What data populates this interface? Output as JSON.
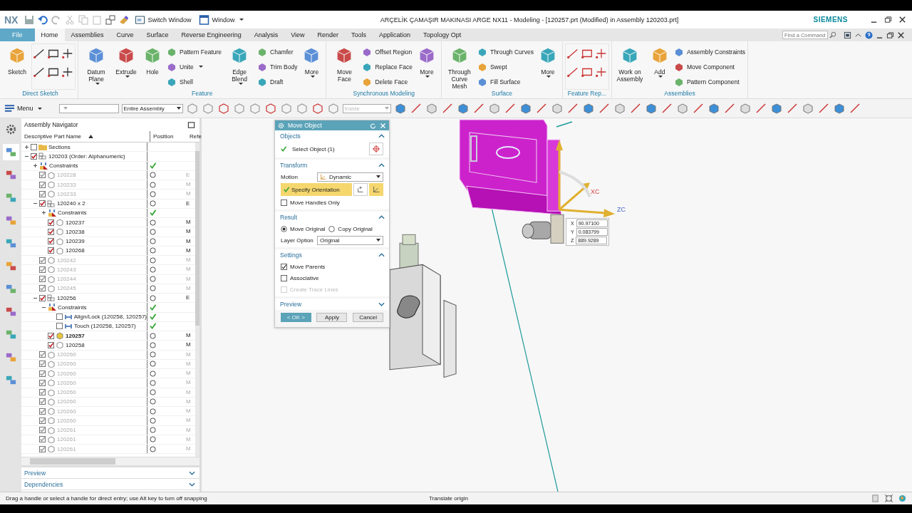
{
  "title_bar": {
    "logo": "NX",
    "switch_window": "Switch Window",
    "window_menu": "Window",
    "title": "ARÇELİK ÇAMAŞIR MAKINASI ARGE NX11 - Modeling - [120257.prt (Modified)  in Assembly 120203.prt]",
    "brand": "SIEMENS"
  },
  "menu_tabs": [
    {
      "label": "File",
      "kind": "file",
      "selected": false
    },
    {
      "label": "Home",
      "kind": "tab",
      "selected": true
    },
    {
      "label": "Assemblies",
      "kind": "tab",
      "selected": false
    },
    {
      "label": "Curve",
      "kind": "tab",
      "selected": false
    },
    {
      "label": "Surface",
      "kind": "tab",
      "selected": false
    },
    {
      "label": "Reverse Engineering",
      "kind": "tab",
      "selected": false
    },
    {
      "label": "Analysis",
      "kind": "tab",
      "selected": false
    },
    {
      "label": "View",
      "kind": "tab",
      "selected": false
    },
    {
      "label": "Render",
      "kind": "tab",
      "selected": false
    },
    {
      "label": "Tools",
      "kind": "tab",
      "selected": false
    },
    {
      "label": "Application",
      "kind": "tab",
      "selected": false
    },
    {
      "label": "Topology Opt",
      "kind": "tab",
      "selected": false
    }
  ],
  "command_search": {
    "placeholder": "Find a Command"
  },
  "ribbon_groups": [
    {
      "label": "Direct Sketch",
      "items": [
        {
          "kind": "large",
          "label": "Sketch",
          "dropdown": false
        },
        {
          "kind": "grid"
        }
      ]
    },
    {
      "label": "Feature",
      "items": [
        {
          "kind": "large",
          "label": "Datum Plane",
          "dropdown": true
        },
        {
          "kind": "large",
          "label": "Extrude",
          "dropdown": true
        },
        {
          "kind": "large",
          "label": "Hole",
          "dropdown": false
        },
        {
          "kind": "stack",
          "entries": [
            {
              "label": "Pattern Feature",
              "dropdown": false
            },
            {
              "label": "Unite",
              "dropdown": true
            },
            {
              "label": "Shell",
              "dropdown": false
            }
          ]
        },
        {
          "kind": "large",
          "label": "Edge Blend",
          "dropdown": true
        },
        {
          "kind": "stack",
          "entries": [
            {
              "label": "Chamfer",
              "dropdown": false
            },
            {
              "label": "Trim Body",
              "dropdown": false
            },
            {
              "label": "Draft",
              "dropdown": false
            }
          ]
        },
        {
          "kind": "large",
          "label": "More",
          "dropdown": true
        }
      ]
    },
    {
      "label": "Synchronous Modeling",
      "items": [
        {
          "kind": "large",
          "label": "Move Face",
          "dropdown": false
        },
        {
          "kind": "stack",
          "entries": [
            {
              "label": "Offset Region",
              "dropdown": false
            },
            {
              "label": "Replace Face",
              "dropdown": false
            },
            {
              "label": "Delete Face",
              "dropdown": false
            }
          ]
        },
        {
          "kind": "large",
          "label": "More",
          "dropdown": true
        }
      ]
    },
    {
      "label": "Surface",
      "items": [
        {
          "kind": "large",
          "label": "Through Curve Mesh",
          "dropdown": false
        },
        {
          "kind": "stack",
          "entries": [
            {
              "label": "Through Curves",
              "dropdown": false
            },
            {
              "label": "Swept",
              "dropdown": false
            },
            {
              "label": "Fill Surface",
              "dropdown": false
            }
          ]
        },
        {
          "kind": "large",
          "label": "More",
          "dropdown": true
        }
      ]
    },
    {
      "label": "Feature Rep...",
      "items": [
        {
          "kind": "grid"
        }
      ]
    },
    {
      "label": "Assemblies",
      "items": [
        {
          "kind": "large",
          "label": "Work on Assembly",
          "dropdown": false
        },
        {
          "kind": "large",
          "label": "Add",
          "dropdown": true
        },
        {
          "kind": "stack",
          "entries": [
            {
              "label": "Assembly Constraints",
              "dropdown": false
            },
            {
              "label": "Move Component",
              "dropdown": false
            },
            {
              "label": "Pattern Component",
              "dropdown": false
            }
          ]
        }
      ]
    }
  ],
  "selection_bar": {
    "menu": "Menu",
    "scope": "Entire Assembly",
    "inside": "Inside"
  },
  "navigator": {
    "title": "Assembly Navigator",
    "columns": [
      "Descriptive Part Name",
      "Position",
      "Refe"
    ],
    "tree": [
      {
        "name": "Sections",
        "kind": "folder",
        "checked": false,
        "dimmed": false,
        "work": false,
        "expanded": false
      },
      {
        "name": "120203 (Order: Alphanumeric)",
        "kind": "assembly",
        "checked": true,
        "dimmed": false,
        "work": false,
        "expanded": true,
        "children": [
          {
            "name": "Constraints",
            "kind": "constraints",
            "dimmed": false,
            "work": false,
            "expanded": false,
            "positioned": true
          },
          {
            "name": "120228",
            "kind": "part",
            "checked": true,
            "dimmed": true,
            "work": false,
            "positioned": false,
            "reference": "E"
          },
          {
            "name": "120233",
            "kind": "part",
            "checked": true,
            "dimmed": true,
            "work": false,
            "positioned": false,
            "reference": "M"
          },
          {
            "name": "120233",
            "kind": "part",
            "checked": true,
            "dimmed": true,
            "work": false,
            "positioned": false,
            "reference": "M"
          },
          {
            "name": "120240 x 2",
            "kind": "assembly",
            "checked": true,
            "dimmed": false,
            "work": false,
            "expanded": true,
            "positioned": false,
            "reference": "E",
            "children": [
              {
                "name": "Constraints",
                "kind": "constraints",
                "dimmed": false,
                "work": false,
                "expanded": false,
                "positioned": true
              },
              {
                "name": "120237",
                "kind": "part",
                "checked": true,
                "dimmed": false,
                "work": false,
                "positioned": false,
                "reference": "M"
              },
              {
                "name": "120238",
                "kind": "part",
                "checked": true,
                "dimmed": false,
                "work": false,
                "positioned": false,
                "reference": "M"
              },
              {
                "name": "120239",
                "kind": "part",
                "checked": true,
                "dimmed": false,
                "work": false,
                "positioned": false,
                "reference": "M"
              },
              {
                "name": "120268",
                "kind": "part",
                "checked": true,
                "dimmed": false,
                "work": false,
                "positioned": false,
                "reference": "M"
              }
            ]
          },
          {
            "name": "120242",
            "kind": "part",
            "checked": true,
            "dimmed": true,
            "work": false,
            "positioned": false,
            "reference": "M"
          },
          {
            "name": "120243",
            "kind": "part",
            "checked": true,
            "dimmed": true,
            "work": false,
            "positioned": false,
            "reference": "M"
          },
          {
            "name": "120244",
            "kind": "part",
            "checked": true,
            "dimmed": true,
            "work": false,
            "positioned": false,
            "reference": "M"
          },
          {
            "name": "120245",
            "kind": "part",
            "checked": true,
            "dimmed": true,
            "work": false,
            "positioned": false,
            "reference": "M"
          },
          {
            "name": "120256",
            "kind": "assembly",
            "checked": true,
            "dimmed": false,
            "work": false,
            "expanded": true,
            "positioned": false,
            "reference": "E",
            "children": [
              {
                "name": "Constraints",
                "kind": "constraints",
                "dimmed": false,
                "work": false,
                "expanded": true,
                "positioned": true,
                "children": [
                  {
                    "name": "Align/Lock (120258, 120257)",
                    "kind": "constraint",
                    "checked": false,
                    "dimmed": false,
                    "work": false,
                    "positioned": true
                  },
                  {
                    "name": "Touch (120258, 120257)",
                    "kind": "constraint",
                    "checked": false,
                    "dimmed": false,
                    "work": false,
                    "positioned": true
                  }
                ]
              },
              {
                "name": "120257",
                "kind": "part",
                "checked": true,
                "dimmed": false,
                "work": true,
                "positioned": false,
                "reference": "M"
              },
              {
                "name": "120258",
                "kind": "part",
                "checked": true,
                "dimmed": false,
                "work": false,
                "positioned": false,
                "reference": "M"
              }
            ]
          },
          {
            "name": "120260",
            "kind": "part",
            "checked": true,
            "dimmed": true,
            "work": false,
            "positioned": false,
            "reference": "M"
          },
          {
            "name": "120260",
            "kind": "part",
            "checked": true,
            "dimmed": true,
            "work": false,
            "positioned": false,
            "reference": "M"
          },
          {
            "name": "120260",
            "kind": "part",
            "checked": true,
            "dimmed": true,
            "work": false,
            "positioned": false,
            "reference": "M"
          },
          {
            "name": "120260",
            "kind": "part",
            "checked": true,
            "dimmed": true,
            "work": false,
            "positioned": false,
            "reference": "M"
          },
          {
            "name": "120260",
            "kind": "part",
            "checked": true,
            "dimmed": true,
            "work": false,
            "positioned": false,
            "reference": "M"
          },
          {
            "name": "120260",
            "kind": "part",
            "checked": true,
            "dimmed": true,
            "work": false,
            "positioned": false,
            "reference": "M"
          },
          {
            "name": "120260",
            "kind": "part",
            "checked": true,
            "dimmed": true,
            "work": false,
            "positioned": false,
            "reference": "M"
          },
          {
            "name": "120260",
            "kind": "part",
            "checked": true,
            "dimmed": true,
            "work": false,
            "positioned": false,
            "reference": "M"
          },
          {
            "name": "120261",
            "kind": "part",
            "checked": true,
            "dimmed": true,
            "work": false,
            "positioned": false,
            "reference": "M"
          },
          {
            "name": "120261",
            "kind": "part",
            "checked": true,
            "dimmed": true,
            "work": false,
            "positioned": false,
            "reference": "M"
          },
          {
            "name": "120261",
            "kind": "part",
            "checked": true,
            "dimmed": true,
            "work": false,
            "positioned": false,
            "reference": "M"
          }
        ]
      }
    ],
    "panels": [
      {
        "title": "Preview",
        "expanded": false
      },
      {
        "title": "Dependencies",
        "expanded": false
      }
    ]
  },
  "dialog": {
    "title": "Move Object",
    "sections": [
      {
        "kind": "objects",
        "title": "Objects",
        "expanded": true,
        "selector": "Select Object (1)",
        "done": true
      },
      {
        "kind": "transform",
        "title": "Transform",
        "expanded": true,
        "motion_label": "Motion",
        "motion": "Dynamic",
        "orientation": "Specify Orientation",
        "orientation_done": true,
        "options": [
          {
            "label": "Move Handles Only",
            "checked": false,
            "disabled": false
          }
        ]
      },
      {
        "kind": "result",
        "title": "Result",
        "expanded": true,
        "modes": [
          {
            "label": "Move Original",
            "selected": true
          },
          {
            "label": "Copy Original",
            "selected": false
          }
        ],
        "layer_label": "Layer Option",
        "layer": "Original"
      },
      {
        "kind": "settings",
        "title": "Settings",
        "expanded": true,
        "options": [
          {
            "label": "Move Parents",
            "checked": true,
            "disabled": false
          },
          {
            "label": "Associative",
            "checked": false,
            "disabled": false
          },
          {
            "label": "Create Trace Lines",
            "checked": false,
            "disabled": true
          }
        ]
      },
      {
        "kind": "preview",
        "title": "Preview",
        "expanded": false
      }
    ],
    "buttons": [
      {
        "label": "< OK >",
        "kind": "primary"
      },
      {
        "label": "Apply",
        "kind": "normal"
      },
      {
        "label": "Cancel",
        "kind": "normal"
      }
    ]
  },
  "viewport": {
    "axis_labels": [
      "XC",
      "ZC"
    ],
    "coordinates": [
      {
        "axis": "X",
        "value": "90.97100"
      },
      {
        "axis": "Y",
        "value": "0.083799"
      },
      {
        "axis": "Z",
        "value": "889.9289"
      }
    ]
  },
  "status_bar": {
    "prompt": "Drag a handle or select a handle for direct entry; use Alt key to turn off snapping",
    "status": "Translate origin"
  }
}
